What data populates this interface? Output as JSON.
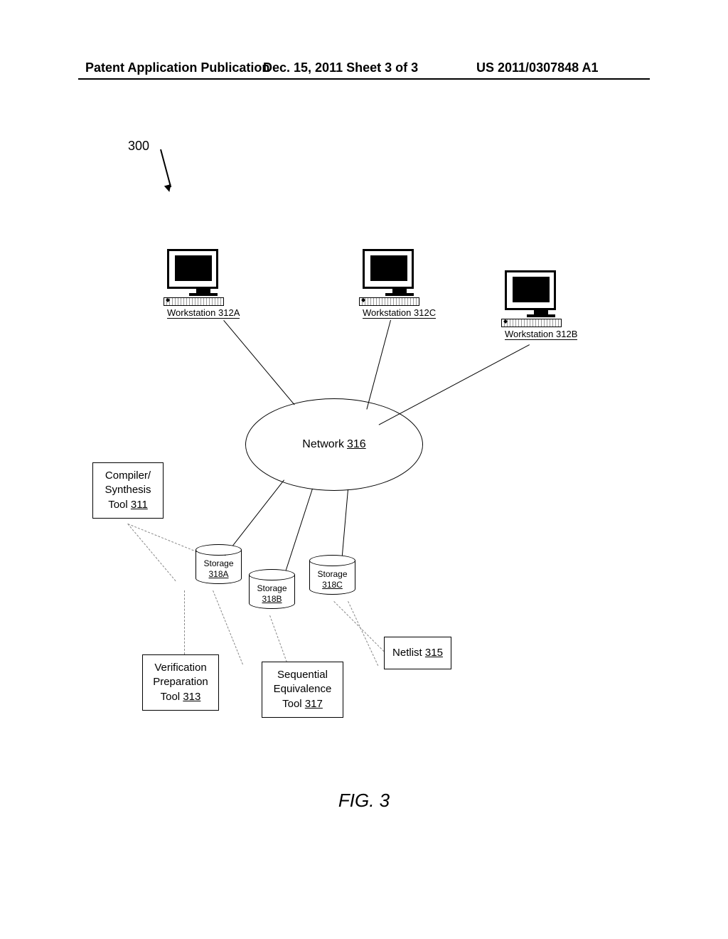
{
  "header": {
    "left": "Patent Application Publication",
    "center": "Dec. 15, 2011  Sheet 3 of 3",
    "right": "US 2011/0307848 A1"
  },
  "ref_number": "300",
  "workstations": {
    "a": {
      "label": "Workstation",
      "id": "312A"
    },
    "b": {
      "label": "Workstation",
      "id": "312B"
    },
    "c": {
      "label": "Workstation",
      "id": "312C"
    }
  },
  "network": {
    "label": "Network",
    "id": "316"
  },
  "boxes": {
    "compiler": {
      "line1": "Compiler/",
      "line2": "Synthesis",
      "line3": "Tool",
      "id": "311"
    },
    "verification": {
      "line1": "Verification",
      "line2": "Preparation",
      "line3": "Tool",
      "id": "313"
    },
    "sequential": {
      "line1": "Sequential",
      "line2": "Equivalence",
      "line3": "Tool",
      "id": "317"
    },
    "netlist": {
      "line1": "Netlist",
      "id": "315"
    }
  },
  "storage": {
    "a": {
      "label": "Storage",
      "id": "318A"
    },
    "b": {
      "label": "Storage",
      "id": "318B"
    },
    "c": {
      "label": "Storage",
      "id": "318C"
    }
  },
  "figure_label": "FIG. 3"
}
